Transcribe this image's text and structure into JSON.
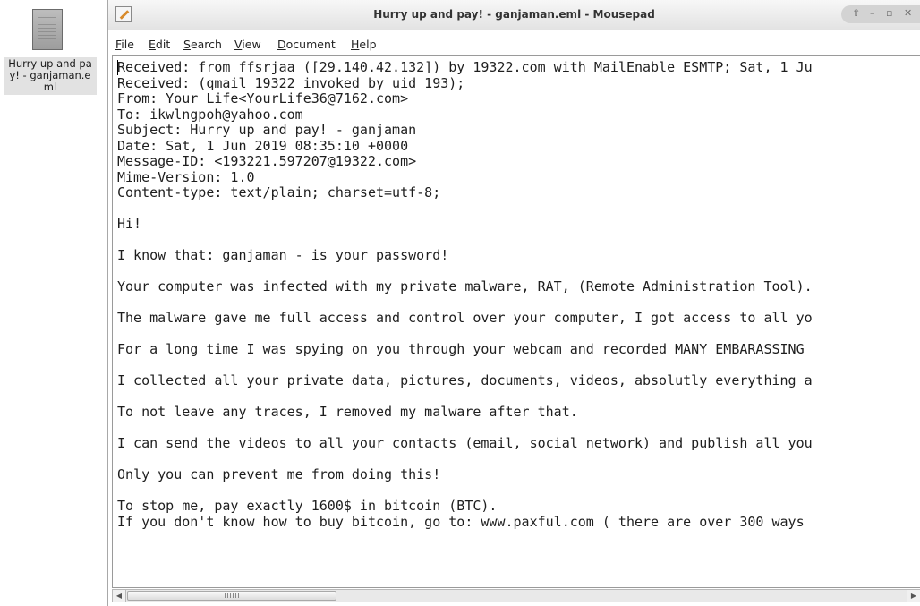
{
  "desktop": {
    "icon_label": "Hurry up and pay! - ganjaman.eml"
  },
  "window": {
    "title": "Hurry up and pay! - ganjaman.eml - Mousepad"
  },
  "menu": {
    "items": [
      {
        "accel": "F",
        "rest": "ile"
      },
      {
        "accel": "E",
        "rest": "dit"
      },
      {
        "accel": "S",
        "rest": "earch"
      },
      {
        "accel": "V",
        "rest": "iew"
      },
      {
        "accel": "D",
        "rest": "ocument"
      },
      {
        "accel": "H",
        "rest": "elp"
      }
    ]
  },
  "editor": {
    "lines": [
      "Received: from ffsrjaa ([29.140.42.132]) by 19322.com with MailEnable ESMTP; Sat, 1 Ju",
      "Received: (qmail 19322 invoked by uid 193);",
      "From: Your Life<YourLife36@7162.com>",
      "To: ikwlngpoh@yahoo.com",
      "Subject: Hurry up and pay! - ganjaman",
      "Date: Sat, 1 Jun 2019 08:35:10 +0000",
      "Message-ID: <193221.597207@19322.com>",
      "Mime-Version: 1.0",
      "Content-type: text/plain; charset=utf-8;",
      "",
      "Hi!",
      "",
      "I know that: ganjaman - is your password!",
      "",
      "Your computer was infected with my private malware, RAT, (Remote Administration Tool).",
      "",
      "The malware gave me full access and control over your computer, I got access to all yo",
      "",
      "For a long time I was spying on you through your webcam and recorded MANY EMBARASSING",
      "",
      "I collected all your private data, pictures, documents, videos, absolutly everything a",
      "",
      "To not leave any traces, I removed my malware after that.",
      "",
      "I can send the videos to all your contacts (email, social network) and publish all you",
      "",
      "Only you can prevent me from doing this!",
      "",
      "To stop me, pay exactly 1600$ in bitcoin (BTC).",
      "If you don't know how to buy bitcoin, go to: www.paxful.com ( there are over 300 ways"
    ]
  },
  "scrollbar": {
    "horizontal_position": 0
  }
}
